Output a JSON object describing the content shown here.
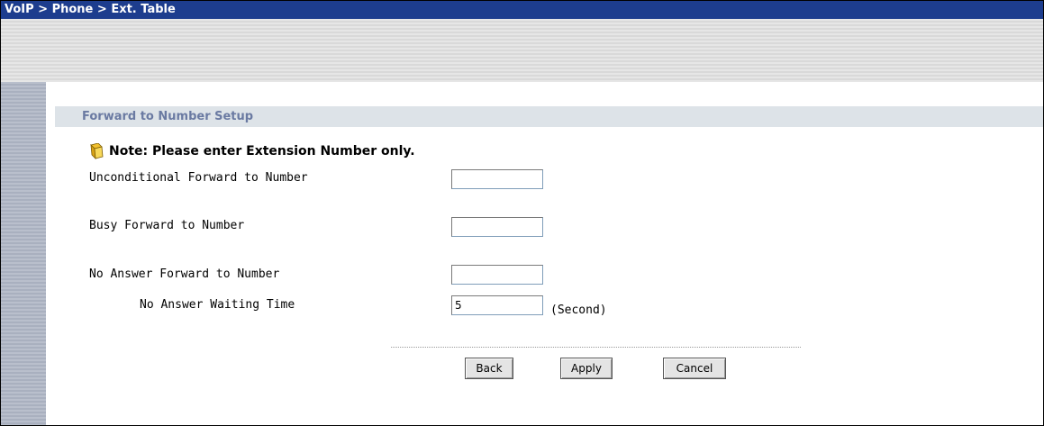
{
  "breadcrumb": "VoIP > Phone > Ext. Table",
  "section": {
    "title": "Forward to Number Setup"
  },
  "note": {
    "text": "Note: Please enter Extension Number only."
  },
  "fields": {
    "unconditional": {
      "label": "Unconditional Forward to Number",
      "value": ""
    },
    "busy": {
      "label": "Busy Forward to Number",
      "value": ""
    },
    "no_answer": {
      "label": "No Answer Forward to Number",
      "value": ""
    },
    "waiting_time": {
      "label": "No Answer Waiting Time",
      "value": "5",
      "unit": "(Second)"
    }
  },
  "buttons": {
    "back": "Back",
    "apply": "Apply",
    "cancel": "Cancel"
  },
  "colors": {
    "title_bar": "#1d3d8e",
    "section_title": "#6a7aa2",
    "section_band": "#dde3e8"
  },
  "icons": {
    "note": "note-book-icon"
  }
}
